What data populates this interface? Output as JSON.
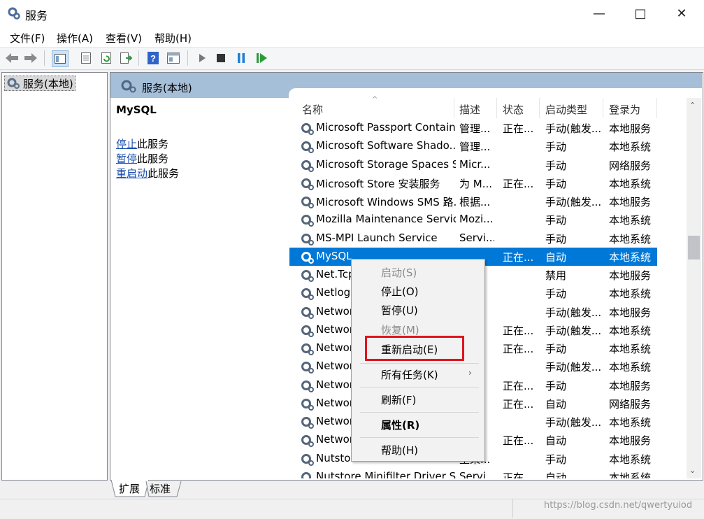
{
  "window": {
    "title": "服务"
  },
  "menu": [
    "文件(F)",
    "操作(A)",
    "查看(V)",
    "帮助(H)"
  ],
  "tree": {
    "item": "服务(本地)"
  },
  "header": {
    "label": "服务(本地)"
  },
  "detail": {
    "service_name": "MySQL",
    "actions": [
      {
        "link": "停止",
        "suffix": "此服务"
      },
      {
        "link": "暂停",
        "suffix": "此服务"
      },
      {
        "link": "重启动",
        "suffix": "此服务"
      }
    ]
  },
  "columns": [
    "名称",
    "描述",
    "状态",
    "启动类型",
    "登录为"
  ],
  "rows": [
    {
      "name": "Microsoft Passport Container",
      "desc": "管理...",
      "status": "正在...",
      "startup": "手动(触发...",
      "logon": "本地服务"
    },
    {
      "name": "Microsoft Software Shado...",
      "desc": "管理...",
      "status": "",
      "startup": "手动",
      "logon": "本地系统"
    },
    {
      "name": "Microsoft Storage Spaces S...",
      "desc": "Micr...",
      "status": "",
      "startup": "手动",
      "logon": "网络服务"
    },
    {
      "name": "Microsoft Store 安装服务",
      "desc": "为 M...",
      "status": "正在...",
      "startup": "手动",
      "logon": "本地系统"
    },
    {
      "name": "Microsoft Windows SMS 路...",
      "desc": "根据...",
      "status": "",
      "startup": "手动(触发...",
      "logon": "本地服务"
    },
    {
      "name": "Mozilla Maintenance Service",
      "desc": "Mozi...",
      "status": "",
      "startup": "手动",
      "logon": "本地系统"
    },
    {
      "name": "MS-MPI Launch Service",
      "desc": "Servi...",
      "status": "",
      "startup": "手动",
      "logon": "本地系统"
    },
    {
      "name": "MySQL",
      "desc": "",
      "status": "正在...",
      "startup": "自动",
      "logon": "本地系统",
      "selected": true
    },
    {
      "name": "Net.Tcp",
      "desc": "",
      "status": "",
      "startup": "禁用",
      "logon": "本地服务"
    },
    {
      "name": "Netlogo",
      "desc": "",
      "status": "",
      "startup": "手动",
      "logon": "本地系统"
    },
    {
      "name": "Networ",
      "desc": "",
      "status": "",
      "startup": "手动(触发...",
      "logon": "本地服务"
    },
    {
      "name": "Networ",
      "desc": "",
      "status": "正在...",
      "startup": "手动(触发...",
      "logon": "本地系统"
    },
    {
      "name": "Networ",
      "desc": "",
      "status": "正在...",
      "startup": "手动",
      "logon": "本地系统"
    },
    {
      "name": "Networ",
      "desc": "",
      "status": "",
      "startup": "手动(触发...",
      "logon": "本地系统"
    },
    {
      "name": "Networ",
      "desc": "",
      "status": "正在...",
      "startup": "手动",
      "logon": "本地服务"
    },
    {
      "name": "Networ",
      "desc": "",
      "status": "正在...",
      "startup": "自动",
      "logon": "网络服务"
    },
    {
      "name": "Networ",
      "desc": "",
      "status": "",
      "startup": "手动(触发...",
      "logon": "本地系统"
    },
    {
      "name": "Networ",
      "desc": "",
      "status": "正在...",
      "startup": "自动",
      "logon": "本地服务"
    },
    {
      "name": "Nutstore Maintenance Serv...",
      "desc": "坚果...",
      "status": "",
      "startup": "手动",
      "logon": "本地系统"
    },
    {
      "name": "Nutstore Minifilter Driver S...",
      "desc": "Servi...",
      "status": "正在...",
      "startup": "自动",
      "logon": "本地系统"
    }
  ],
  "context_menu": [
    "启动(S)",
    "停止(O)",
    "暂停(U)",
    "恢复(M)",
    "重新启动(E)",
    "所有任务(K)",
    "刷新(F)",
    "属性(R)",
    "帮助(H)"
  ],
  "tabs": [
    "扩展",
    "标准"
  ],
  "watermark": "https://blog.csdn.net/qwertyuiod",
  "colors": {
    "selection": "#0078d7",
    "header": "#a6bfd8",
    "link": "#1a4fae",
    "highlight_box": "#e0141c"
  },
  "icons": [
    "services-gear-icon",
    "back-arrow-icon",
    "forward-arrow-icon",
    "play-icon",
    "stop-icon",
    "pause-icon",
    "resume-icon",
    "help-icon"
  ]
}
